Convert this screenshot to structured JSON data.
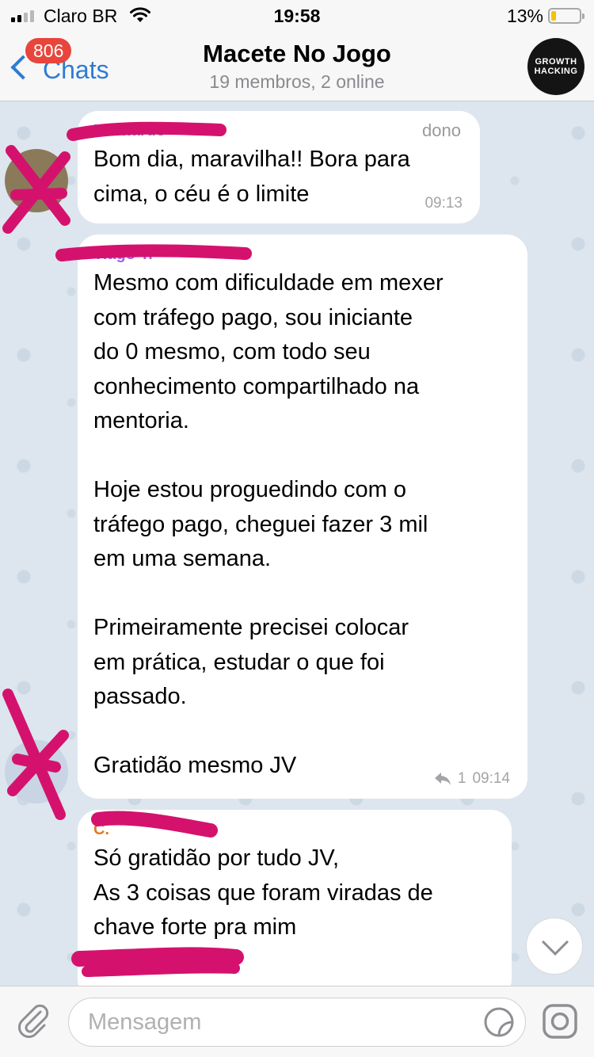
{
  "status_bar": {
    "carrier": "Claro BR",
    "time": "19:58",
    "battery_percent": "13%",
    "battery_level": 0.13
  },
  "header": {
    "back_label": "Chats",
    "unread_count": "806",
    "title": "Macete No Jogo",
    "subtitle": "19 membros, 2 online",
    "avatar_text_line1": "GROWTH",
    "avatar_text_line2": "HACKING"
  },
  "messages": [
    {
      "sender": "Leonardo",
      "role": "dono",
      "text": "Bom dia, maravilha!! Bora para\ncima, o céu é o limite",
      "time": "09:13"
    },
    {
      "sender": "Tiago Y.",
      "text": "Mesmo com dificuldade em mexer\ncom tráfego pago, sou iniciante\ndo 0 mesmo, com todo seu\nconhecimento compartilhado na\nmentoria.\n\nHoje estou proguedindo com o\ntráfego pago, cheguei fazer 3 mil\nem uma semana.\n\nPrimeiramente precisei colocar\nem prática, estudar o que foi\npassado.\n\nGratidão mesmo JV",
      "reply_count": "1",
      "time": "09:14"
    },
    {
      "sender": "C.",
      "text": "Só gratidão por tudo JV,\nAs 3 coisas que foram viradas de\nchave forte pra mim"
    }
  ],
  "input": {
    "placeholder": "Mensagem"
  },
  "colors": {
    "accent": "#2d7cd3",
    "badge": "#e8453c",
    "redaction": "#d4126e"
  },
  "icons": [
    "signal-icon",
    "wifi-icon",
    "battery-icon",
    "back-chevron-icon",
    "reply-icon",
    "chevron-down-icon",
    "paperclip-icon",
    "sticker-icon",
    "camera-icon"
  ]
}
